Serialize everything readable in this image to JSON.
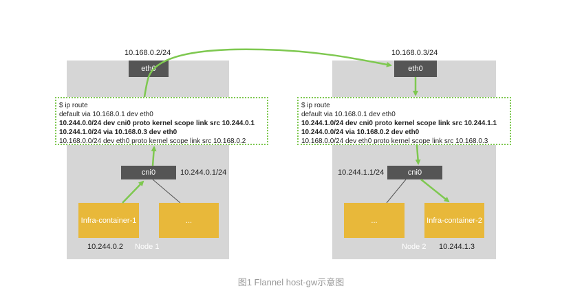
{
  "left_node": {
    "eth0_ip": "10.168.0.2/24",
    "eth0_label": "eth0",
    "routes": [
      {
        "text": "$ ip route",
        "bold": false
      },
      {
        "text": "default via 10.168.0.1 dev eth0",
        "bold": false
      },
      {
        "text": "10.244.0.0/24 dev cni0 proto kernel scope link src 10.244.0.1",
        "bold": true
      },
      {
        "text": "10.244.1.0/24 via 10.168.0.3 dev eth0",
        "bold": true
      },
      {
        "text": "10.168.0.0/24 dev eth0 proto kernel scope link src 10.168.0.2",
        "bold": false
      }
    ],
    "cni0_label": "cni0",
    "cni0_ip": "10.244.0.1/24",
    "infra_container_label": "Infra-container-1",
    "other_container_label": "...",
    "container_ip": "10.244.0.2",
    "node_name": "Node 1"
  },
  "right_node": {
    "eth0_ip": "10.168.0.3/24",
    "eth0_label": "eth0",
    "routes": [
      {
        "text": "$ ip route",
        "bold": false
      },
      {
        "text": "default via 10.168.0.1 dev eth0",
        "bold": false
      },
      {
        "text": "10.244.1.0/24 dev cni0 proto kernel scope link src 10.244.1.1",
        "bold": true
      },
      {
        "text": "10.244.0.0/24 via 10.168.0.2 dev eth0",
        "bold": true
      },
      {
        "text": "10.168.0.0/24 dev eth0 proto kernel scope link src 10.168.0.3",
        "bold": false
      }
    ],
    "cni0_label": "cni0",
    "cni0_ip": "10.244.1.1/24",
    "infra_container_label": "Infra-container-2",
    "other_container_label": "...",
    "container_ip": "10.244.1.3",
    "node_name": "Node 2"
  },
  "caption": "图1 Flannel host-gw示意图",
  "colors": {
    "node_bg": "#d6d6d6",
    "device_box": "#555555",
    "container": "#e8b83a",
    "arrow": "#7ec850",
    "route_border": "#7ec850",
    "caption": "#999999"
  }
}
